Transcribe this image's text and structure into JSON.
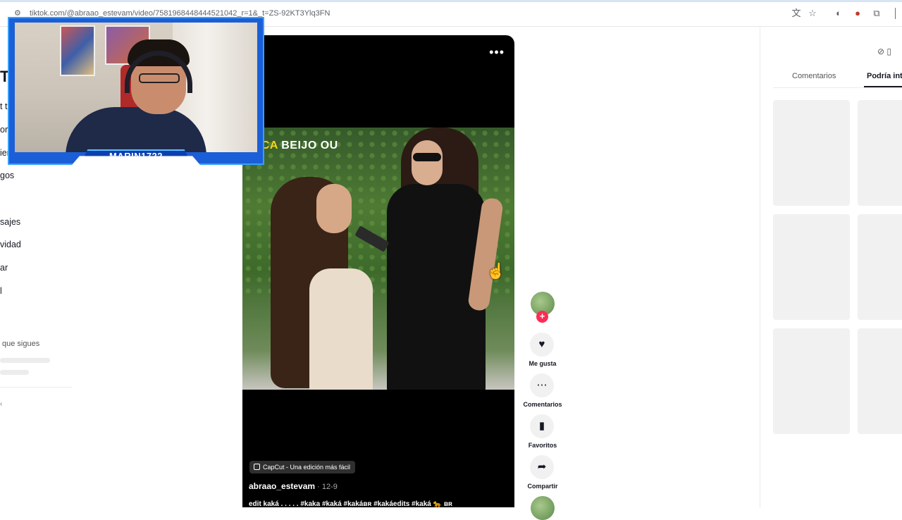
{
  "browser": {
    "url": "tiktok.com/@abraao_estevam/video/7581968448444521042_r=1&_t=ZS-92KT3Ylq3FN",
    "icons": [
      "site-info-icon",
      "translate-icon",
      "star-icon",
      "extension-icon",
      "record-icon",
      "puzzle-icon"
    ]
  },
  "sidebar": {
    "logo": "To",
    "items": [
      "t ti",
      "ora",
      "ier",
      "gos",
      "sajes",
      "vidad",
      "ar",
      "l"
    ],
    "following_label": "que sigues",
    "more_label": "‹"
  },
  "webcam": {
    "streamer_name": "MARIN1722"
  },
  "video": {
    "overlay_caption_prefix": "MOCA",
    "overlay_caption_rest": " BEIJO OU",
    "menu_label": "•••",
    "capcut_label": "CapCut - Una edición más fácil",
    "author": "abraao_estevam",
    "date": " · 12-9",
    "description": "edit kaká . . . . . #kaka #kaká #kakáʙʀ #kakáedits #kaká 🐆 ʙʀ"
  },
  "actions": {
    "like_label": "Me gusta",
    "comments_label": "Comentarios",
    "favorites_label": "Favoritos",
    "share_label": "Compartir"
  },
  "right_panel": {
    "tab_comments": "Comentarios",
    "tab_suggest": "Podría int"
  },
  "colors": {
    "accent_red": "#fe2c55",
    "webcam_blue": "#1b5fd8",
    "caption_yellow": "#f7d417"
  }
}
